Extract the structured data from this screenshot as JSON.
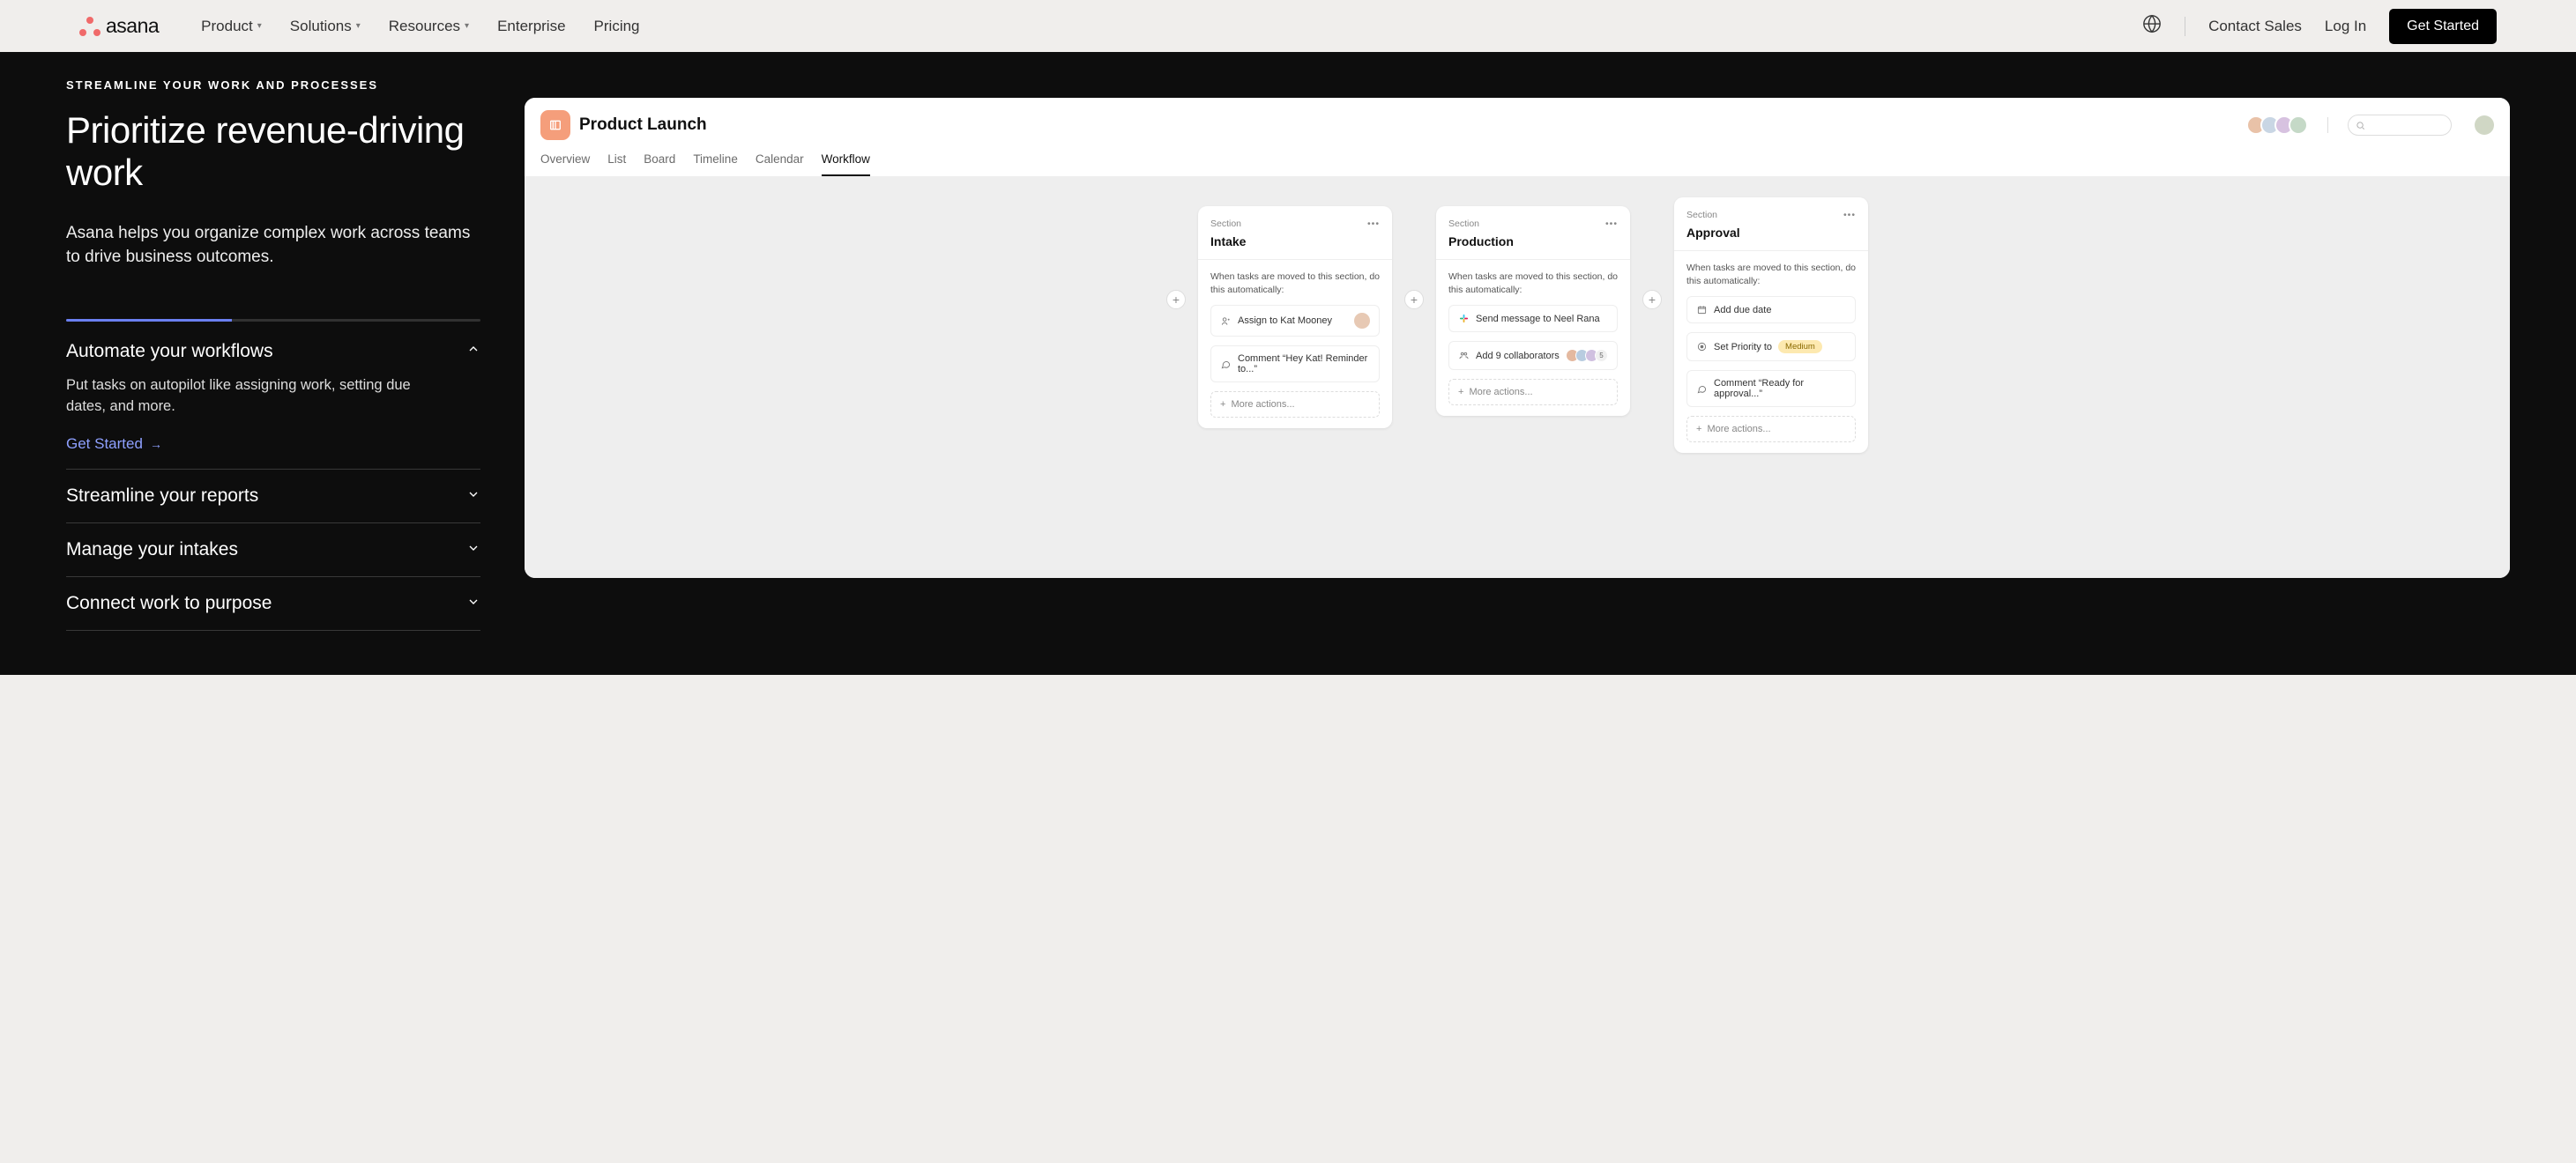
{
  "nav": {
    "brand": "asana",
    "items": [
      "Product",
      "Solutions",
      "Resources",
      "Enterprise",
      "Pricing"
    ],
    "contact": "Contact Sales",
    "login": "Log In",
    "cta": "Get Started"
  },
  "hero": {
    "eyebrow": "STREAMLINE YOUR WORK AND PROCESSES",
    "title": "Prioritize revenue-driving work",
    "sub": "Asana helps you organize complex work across teams to drive business outcomes."
  },
  "accordion": {
    "open": {
      "title": "Automate your workflows",
      "body": "Put tasks on autopilot like assigning work, setting due dates, and more.",
      "cta": "Get Started"
    },
    "closed": [
      "Streamline your reports",
      "Manage your intakes",
      "Connect work to purpose"
    ]
  },
  "app": {
    "title": "Product Launch",
    "tabs": [
      "Overview",
      "List",
      "Board",
      "Timeline",
      "Calendar",
      "Workflow"
    ],
    "activeTab": "Workflow",
    "search_placeholder": ""
  },
  "workflow": {
    "section_label": "Section",
    "helper": "When tasks are moved to this section, do this automatically:",
    "more": "More actions...",
    "cards": [
      {
        "title": "Intake",
        "actions": [
          {
            "icon": "assign",
            "text": "Assign to Kat Mooney",
            "avatar": true
          },
          {
            "icon": "comment",
            "text": "Comment “Hey Kat! Reminder to...”"
          }
        ]
      },
      {
        "title": "Production",
        "actions": [
          {
            "icon": "slack",
            "text": "Send message to Neel Rana"
          },
          {
            "icon": "collab",
            "text": "Add 9 collaborators",
            "multi": true,
            "multi_count": "5"
          }
        ]
      },
      {
        "title": "Approval",
        "actions": [
          {
            "icon": "date",
            "text": "Add due date"
          },
          {
            "icon": "priority",
            "text": "Set Priority to",
            "badge": "Medium"
          },
          {
            "icon": "comment",
            "text": "Comment “Ready for approval...”"
          }
        ]
      }
    ]
  }
}
